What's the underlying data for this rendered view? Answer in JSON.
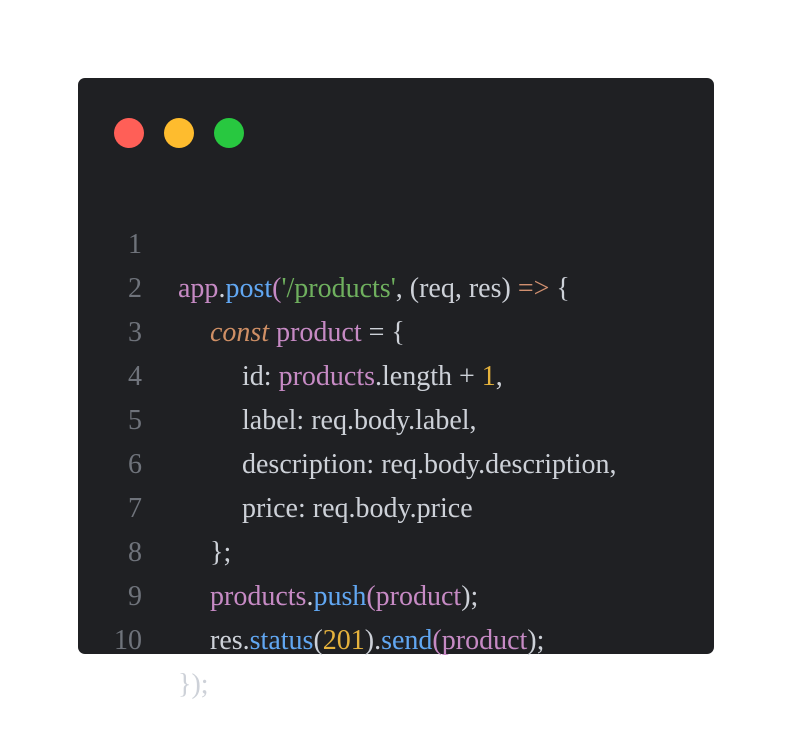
{
  "window": {
    "controls": {
      "close_color": "#ff5f57",
      "minimize_color": "#febc2e",
      "maximize_color": "#28c840"
    }
  },
  "code": {
    "lines": [
      {
        "number": "1",
        "tokens": [
          "app",
          ".",
          "post",
          "(",
          "'/products'",
          ", (req, res) ",
          "=>",
          " {"
        ]
      },
      {
        "number": "2",
        "tokens": [
          "const",
          " ",
          "product",
          " = {"
        ]
      },
      {
        "number": "3",
        "tokens": [
          "id: ",
          "products",
          ".length + ",
          "1",
          ","
        ]
      },
      {
        "number": "4",
        "tokens": [
          "label: req.body.label,"
        ]
      },
      {
        "number": "5",
        "tokens": [
          "description: req.body.description,"
        ]
      },
      {
        "number": "6",
        "tokens": [
          "price: req.body.price"
        ]
      },
      {
        "number": "7",
        "tokens": [
          "};"
        ]
      },
      {
        "number": "8",
        "tokens": [
          "products",
          ".",
          "push",
          "(",
          "product",
          ");"
        ]
      },
      {
        "number": "9",
        "tokens": [
          "res.",
          "status",
          "(",
          "201",
          ").",
          "send",
          "(",
          "product",
          ");"
        ]
      },
      {
        "number": "10",
        "tokens": [
          "});"
        ]
      }
    ]
  }
}
